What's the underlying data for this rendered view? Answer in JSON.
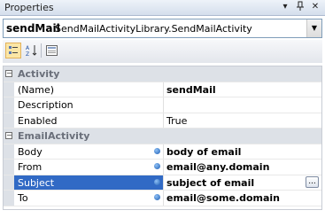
{
  "window": {
    "title": "Properties"
  },
  "selector": {
    "name": "sendMail",
    "type": "SendMailActivityLibrary.SendMailActivity"
  },
  "categories": [
    {
      "label": "Activity",
      "properties": [
        {
          "name": "(Name)",
          "value": "sendMail",
          "bold": true,
          "bound": false
        },
        {
          "name": "Description",
          "value": "",
          "bold": false,
          "bound": false
        },
        {
          "name": "Enabled",
          "value": "True",
          "bold": false,
          "bound": false
        }
      ]
    },
    {
      "label": "EmailActivity",
      "properties": [
        {
          "name": "Body",
          "value": "body of email",
          "bold": true,
          "bound": true
        },
        {
          "name": "From",
          "value": "email@any.domain",
          "bold": true,
          "bound": true
        },
        {
          "name": "Subject",
          "value": "subject of email",
          "bold": true,
          "bound": true,
          "selected": true
        },
        {
          "name": "To",
          "value": "email@some.domain",
          "bold": true,
          "bound": true
        }
      ]
    }
  ],
  "buttons": {
    "ellipsis": "..."
  },
  "icons": {
    "dropdown": "dropdown-arrow-icon",
    "pin": "pin-icon",
    "close": "close-icon",
    "categorized": "categorized-icon",
    "alphabetical": "alphabetical-sort-icon",
    "property_pages": "property-pages-icon",
    "binding": "binding-icon"
  },
  "colors": {
    "selection": "#316ac5",
    "category_bg": "#dde1e7"
  }
}
